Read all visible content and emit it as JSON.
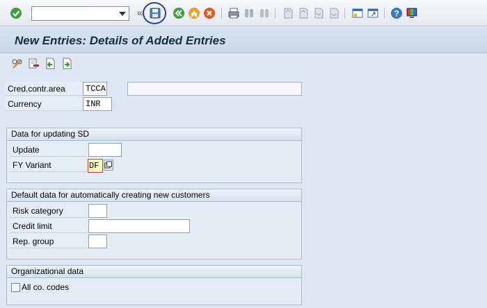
{
  "toolbar": {
    "command_field": {
      "value": "",
      "placeholder": ""
    },
    "icons": [
      "enter-icon",
      "save-icon",
      "back-icon",
      "exit-icon",
      "cancel-icon",
      "print-icon",
      "find-icon",
      "find-next-icon",
      "first-page-icon",
      "previous-page-icon",
      "next-page-icon",
      "last-page-icon",
      "create-session-icon",
      "shortcut-icon",
      "help-icon",
      "customize-layout-icon"
    ]
  },
  "screen": {
    "title": "New Entries: Details of Added Entries",
    "app_icons": [
      "display-change-icon",
      "delete-icon",
      "previous-entry-icon",
      "next-entry-icon"
    ]
  },
  "fields": {
    "cred_contr_area": {
      "label": "Cred.contr.area",
      "value": "TCCA",
      "description": ""
    },
    "currency": {
      "label": "Currency",
      "value": "INR"
    }
  },
  "groups": {
    "sd_update": {
      "title": "Data for updating SD",
      "update": {
        "label": "Update",
        "value": ""
      },
      "fy_variant": {
        "label": "FY Variant",
        "value": "DF"
      }
    },
    "default_data": {
      "title": "Default data for automatically creating new customers",
      "risk_category": {
        "label": "Risk category",
        "value": ""
      },
      "credit_limit": {
        "label": "Credit limit",
        "value": ""
      },
      "rep_group": {
        "label": "Rep. group",
        "value": ""
      }
    },
    "org_data": {
      "title": "Organizational data",
      "all_co_codes": {
        "label": "All co. codes",
        "checked": false
      }
    }
  },
  "colors": {
    "background": "#dfe8f2",
    "title_text": "#1a2c44",
    "highlight": "#fff8bf",
    "save_circle": "#2c3fa6"
  }
}
